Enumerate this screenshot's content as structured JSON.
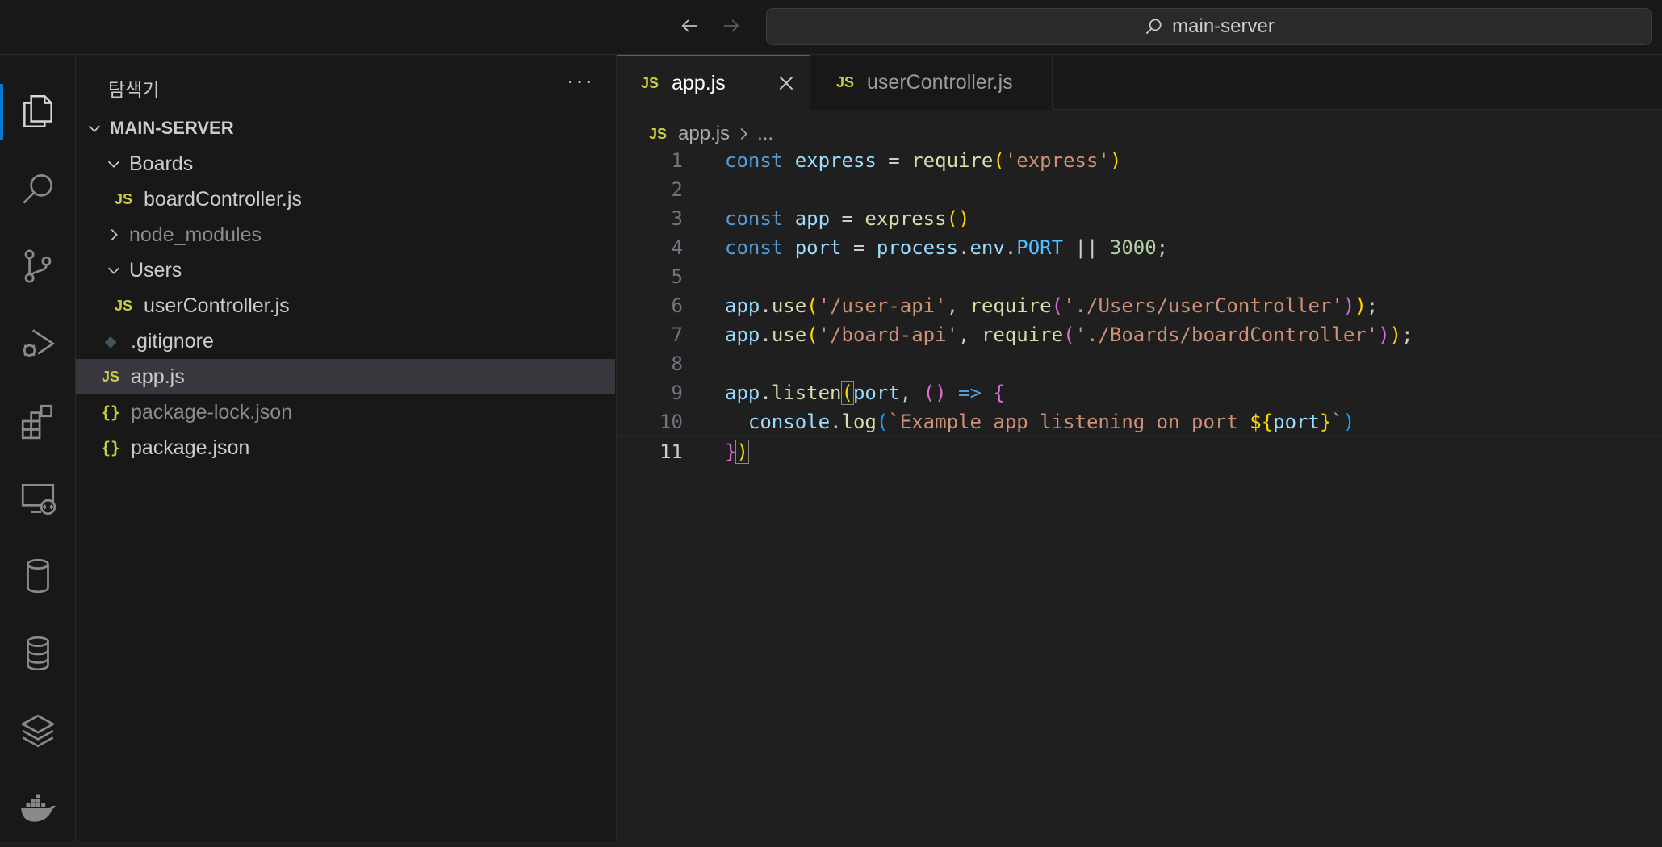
{
  "titlebar": {
    "search_text": "main-server"
  },
  "activity_bar": {
    "items": [
      "explorer-icon",
      "search-icon",
      "source-control-icon",
      "run-debug-icon",
      "extensions-icon",
      "remote-explorer-icon",
      "database-icon",
      "database-stack-icon",
      "layers-icon",
      "docker-icon"
    ],
    "active": "explorer-icon",
    "accent_color": "#0078d4"
  },
  "sidebar": {
    "title": "탐색기",
    "more": "···",
    "tree": [
      {
        "label": "MAIN-SERVER",
        "type": "root",
        "expanded": true
      },
      {
        "label": "Boards",
        "type": "folder",
        "expanded": true
      },
      {
        "label": "boardController.js",
        "type": "js"
      },
      {
        "label": "node_modules",
        "type": "folder",
        "expanded": false
      },
      {
        "label": "Users",
        "type": "folder",
        "expanded": true
      },
      {
        "label": "userController.js",
        "type": "js"
      },
      {
        "label": ".gitignore",
        "type": "git"
      },
      {
        "label": "app.js",
        "type": "js",
        "selected": true
      },
      {
        "label": "package-lock.json",
        "type": "json"
      },
      {
        "label": "package.json",
        "type": "json"
      }
    ],
    "icons": {
      "js": "JS",
      "json": "{}"
    }
  },
  "tabs": [
    {
      "label": "app.js",
      "icon": "JS",
      "active": true
    },
    {
      "label": "userController.js",
      "icon": "JS",
      "active": false
    }
  ],
  "breadcrumb": {
    "icon": "JS",
    "file": "app.js",
    "rest": "..."
  },
  "code": {
    "current_line": 11,
    "lines": [
      "const express = require('express')",
      "",
      "const app = express()",
      "const port = process.env.PORT || 3000;",
      "",
      "app.use('/user-api', require('./Users/userController'));",
      "app.use('/board-api', require('./Boards/boardController'));",
      "",
      "app.listen(port, () => {",
      "  console.log(`Example app listening on port ${port}`)",
      "})"
    ]
  }
}
